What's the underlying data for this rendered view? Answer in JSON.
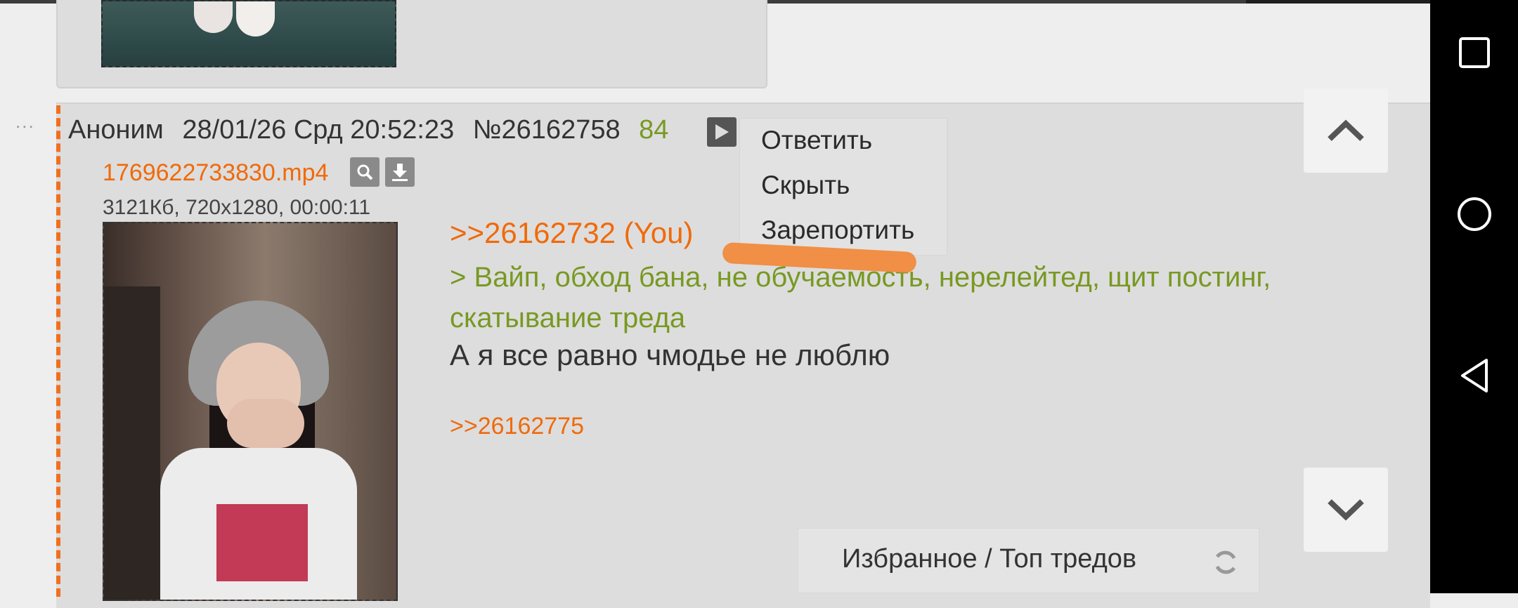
{
  "previous_post": {},
  "post": {
    "options_glyph": "...",
    "author": "Аноним",
    "date": "28/01/26 Срд 20:52:23",
    "number": "№26162758",
    "reply_count": "84",
    "file": {
      "name": "1769622733830.mp4",
      "meta": "3121Кб, 720x1280, 00:00:11"
    },
    "reply_link": ">>26162732 (You)",
    "greentext": "> Вайп, обход бана, не обучаемость, нерелейтед, щит постинг, скатывание треда",
    "body": "А я все равно чмодье не люблю",
    "backlink": ">>26162775"
  },
  "context_menu": {
    "items": [
      "Ответить",
      "Скрыть",
      "Зарепортить"
    ]
  },
  "favorites_bar": {
    "label": "Избранное / Топ тредов"
  },
  "colors": {
    "link_orange": "#f06a0a",
    "greentext": "#789922",
    "scribble": "#f08a3c",
    "post_bg": "#dddddd"
  },
  "icons": {
    "play": "play-icon",
    "search": "search-icon",
    "download": "download-icon",
    "scroll_up": "chevron-up-icon",
    "scroll_down": "chevron-down-icon",
    "refresh": "refresh-icon",
    "nav_recents": "recents-square-icon",
    "nav_home": "home-circle-icon",
    "nav_back": "back-triangle-icon"
  }
}
